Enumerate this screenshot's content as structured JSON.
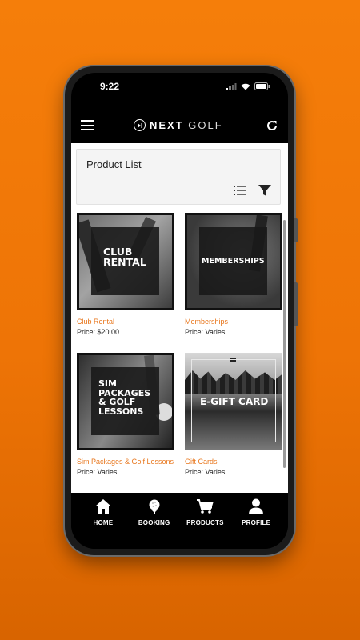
{
  "status_bar": {
    "time": "9:22"
  },
  "header": {
    "brand_part1": "NEXT",
    "brand_part2": "GOLF"
  },
  "product_list": {
    "title": "Product List"
  },
  "products": [
    {
      "image_text": "CLUB RENTAL",
      "name": "Club Rental",
      "price": "Price: $20.00"
    },
    {
      "image_text": "MEMBERSHIPS",
      "name": "Memberships",
      "price": "Price: Varies"
    },
    {
      "image_text": "SIM PACKAGES & GOLF LESSONS",
      "name": "Sim Packages & Golf Lessons",
      "price": "Price: Varies"
    },
    {
      "image_text": "E-GIFT CARD",
      "name": "Gift Cards",
      "price": "Price: Varies"
    }
  ],
  "bottom_nav": [
    {
      "label": "HOME",
      "icon": "home-icon"
    },
    {
      "label": "BOOKING",
      "icon": "golf-ball-tee-icon"
    },
    {
      "label": "PRODUCTS",
      "icon": "cart-icon"
    },
    {
      "label": "PROFILE",
      "icon": "person-icon"
    }
  ],
  "colors": {
    "accent": "#e8761c",
    "background": "#f57e0a"
  }
}
